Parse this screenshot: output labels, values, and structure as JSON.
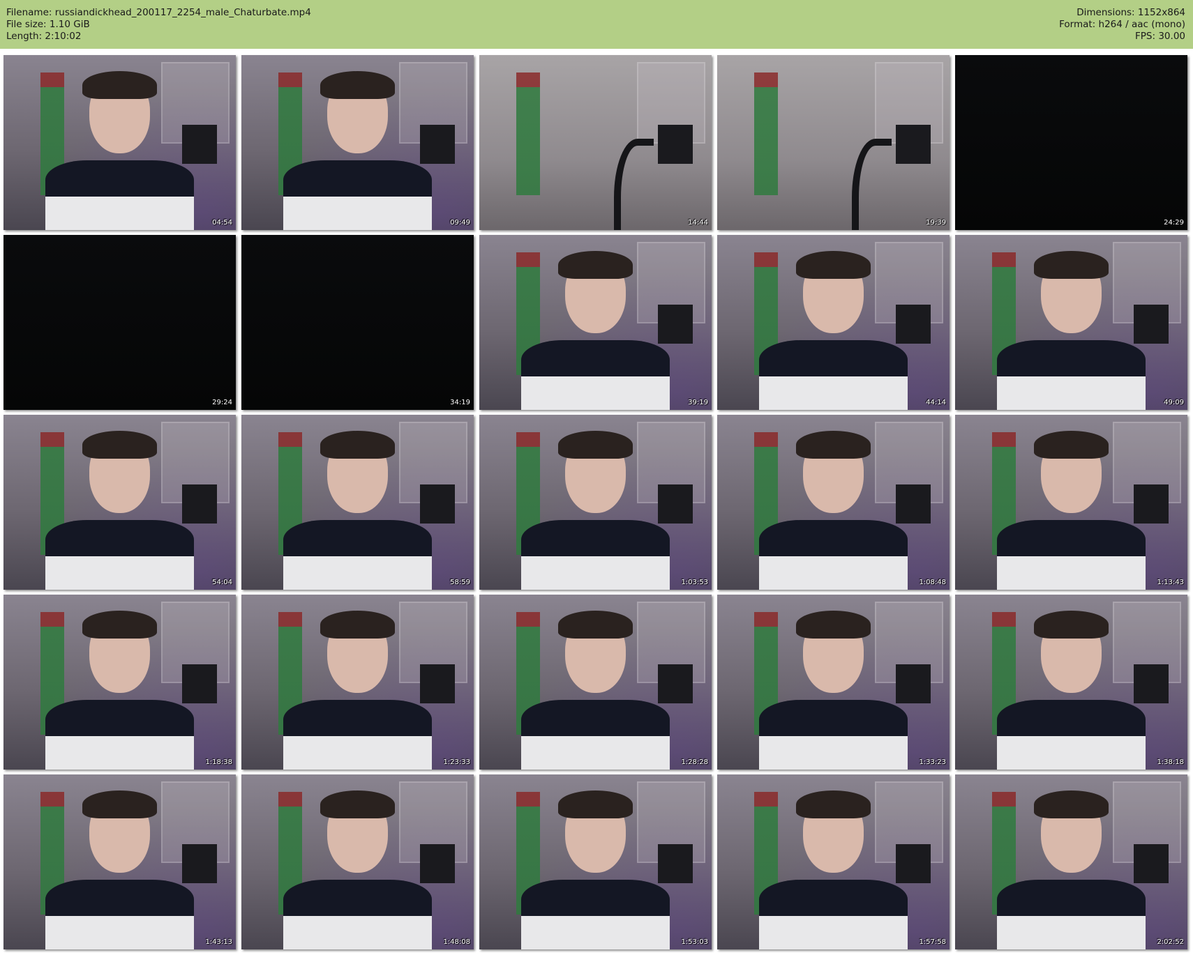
{
  "header": {
    "filename": "Filename: russiandickhead_200117_2254_male_Chaturbate.mp4",
    "file_size": "File size: 1.10 GiB",
    "length": "Length: 2:10:02",
    "dimensions": "Dimensions: 1152x864",
    "format": "Format: h264 / aac (mono)",
    "fps": "FPS: 30.00"
  },
  "thumbnails": [
    {
      "time": "04:54",
      "scene": "person"
    },
    {
      "time": "09:49",
      "scene": "person"
    },
    {
      "time": "14:44",
      "scene": "empty-room"
    },
    {
      "time": "19:39",
      "scene": "empty-room"
    },
    {
      "time": "24:29",
      "scene": "dark"
    },
    {
      "time": "29:24",
      "scene": "dark"
    },
    {
      "time": "34:19",
      "scene": "dark"
    },
    {
      "time": "39:19",
      "scene": "person"
    },
    {
      "time": "44:14",
      "scene": "person"
    },
    {
      "time": "49:09",
      "scene": "person"
    },
    {
      "time": "54:04",
      "scene": "person"
    },
    {
      "time": "58:59",
      "scene": "person"
    },
    {
      "time": "1:03:53",
      "scene": "person"
    },
    {
      "time": "1:08:48",
      "scene": "person"
    },
    {
      "time": "1:13:43",
      "scene": "person"
    },
    {
      "time": "1:18:38",
      "scene": "person"
    },
    {
      "time": "1:23:33",
      "scene": "person"
    },
    {
      "time": "1:28:28",
      "scene": "person"
    },
    {
      "time": "1:33:23",
      "scene": "person"
    },
    {
      "time": "1:38:18",
      "scene": "person"
    },
    {
      "time": "1:43:13",
      "scene": "person"
    },
    {
      "time": "1:48:08",
      "scene": "person"
    },
    {
      "time": "1:53:03",
      "scene": "person"
    },
    {
      "time": "1:57:58",
      "scene": "person"
    },
    {
      "time": "2:02:52",
      "scene": "person"
    }
  ]
}
